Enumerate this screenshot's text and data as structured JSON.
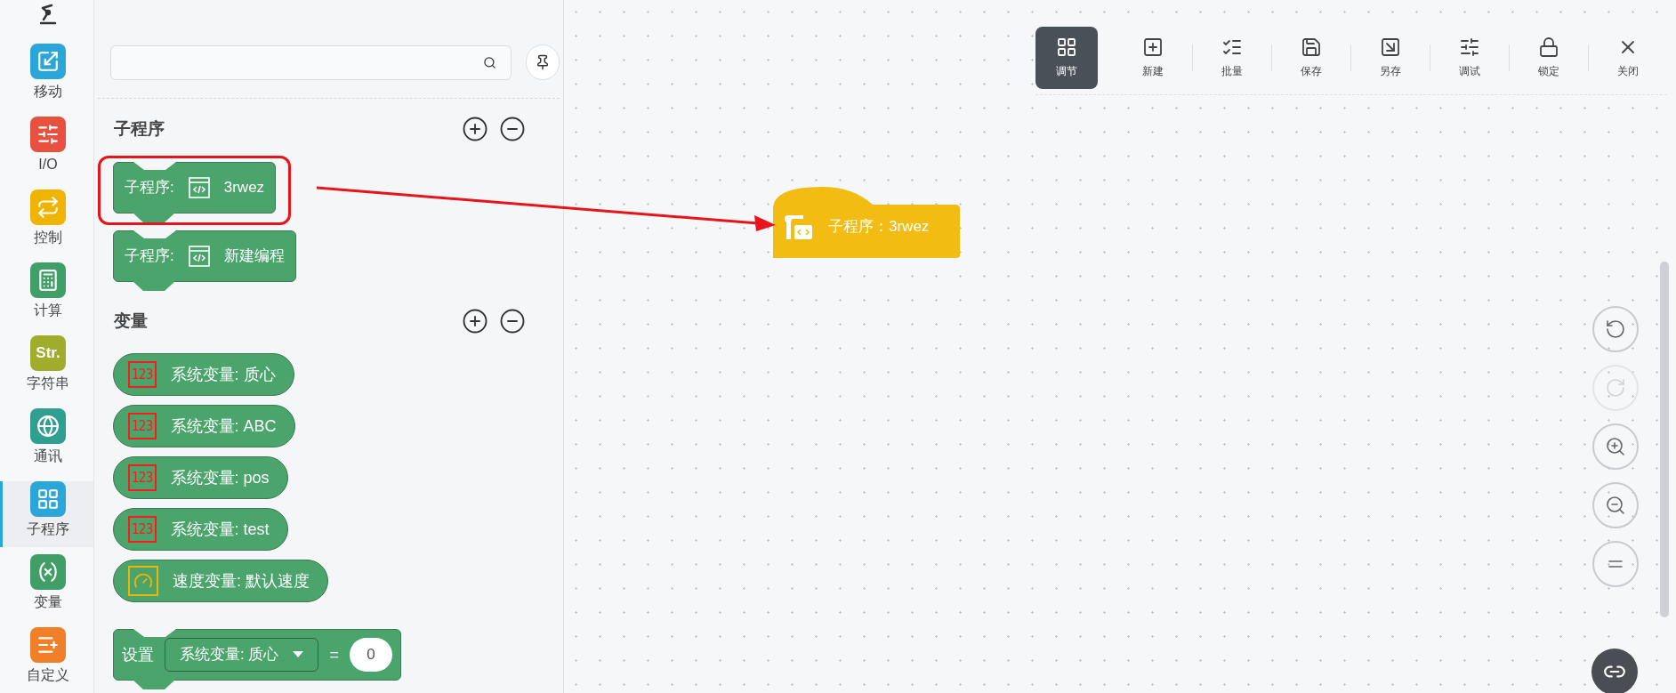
{
  "rail": {
    "items": [
      {
        "label": "移动",
        "kind": "move",
        "color": "#2ba6d9",
        "selected": false
      },
      {
        "label": "I/O",
        "kind": "io",
        "color": "#e8503f",
        "selected": false
      },
      {
        "label": "控制",
        "kind": "control",
        "color": "#f0b400",
        "selected": false
      },
      {
        "label": "计算",
        "kind": "calc",
        "color": "#3f9f66",
        "selected": false
      },
      {
        "label": "字符串",
        "kind": "text",
        "icon_text": "Str.",
        "color": "#a0ac2c",
        "selected": false
      },
      {
        "label": "通讯",
        "kind": "comm",
        "color": "#2f9f8f",
        "selected": false
      },
      {
        "label": "子程序",
        "kind": "subprogram",
        "color": "#2ba6d9",
        "selected": true
      },
      {
        "label": "变量",
        "kind": "variable",
        "color": "#3f9f66",
        "selected": false
      },
      {
        "label": "自定义",
        "kind": "custom",
        "color": "#f07f2a",
        "selected": false
      }
    ]
  },
  "panel": {
    "sections": [
      {
        "title": "子程序",
        "kind": "subprograms",
        "blocks": [
          {
            "label": "子程序:",
            "name": "3rwez",
            "highlighted": true
          },
          {
            "label": "子程序:",
            "name": "新建编程",
            "highlighted": false
          }
        ]
      },
      {
        "title": "变量",
        "kind": "variables",
        "blocks": [
          {
            "kind": "system",
            "badge": "123",
            "label": "系统变量:",
            "name": "质心"
          },
          {
            "kind": "system",
            "badge": "123",
            "label": "系统变量:",
            "name": "ABC"
          },
          {
            "kind": "system",
            "badge": "123",
            "label": "系统变量:",
            "name": "pos"
          },
          {
            "kind": "system",
            "badge": "123",
            "label": "系统变量:",
            "name": "test"
          },
          {
            "kind": "speed",
            "label": "速度变量:",
            "name": "默认速度"
          }
        ]
      }
    ],
    "set_block": {
      "label": "设置",
      "dropdown": "系统变量: 质心",
      "operator": "=",
      "value": "0"
    }
  },
  "toolbar": [
    {
      "label": "调节",
      "kind": "grid",
      "selected": true
    },
    {
      "label": "新建",
      "kind": "new",
      "selected": false
    },
    {
      "label": "批量",
      "kind": "batch",
      "selected": false
    },
    {
      "label": "保存",
      "kind": "save",
      "selected": false
    },
    {
      "label": "另存",
      "kind": "save-as",
      "selected": false
    },
    {
      "label": "调试",
      "kind": "debug",
      "selected": false
    },
    {
      "label": "锁定",
      "kind": "lock",
      "selected": false
    },
    {
      "label": "关闭",
      "kind": "close",
      "selected": false
    }
  ],
  "canvas_block": {
    "label": "子程序：",
    "name": "3rwez"
  },
  "canvas_controls": [
    {
      "kind": "undo",
      "disabled": false
    },
    {
      "kind": "redo",
      "disabled": true
    },
    {
      "kind": "zoom-in",
      "disabled": false
    },
    {
      "kind": "zoom-out",
      "disabled": false
    },
    {
      "kind": "reset",
      "disabled": false
    }
  ]
}
